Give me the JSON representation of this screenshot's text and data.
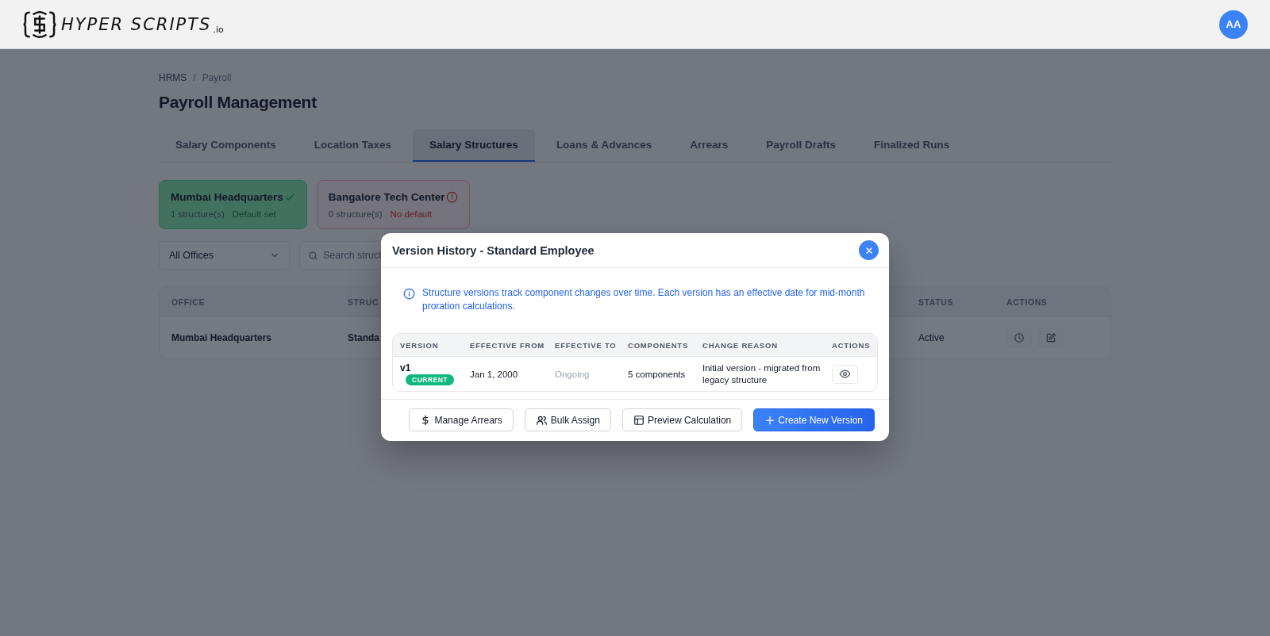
{
  "header": {
    "logo_text": "HYPER SCRIPTS",
    "logo_suffix": ".io",
    "avatar": "AA"
  },
  "breadcrumb": {
    "items": [
      "HRMS",
      "Payroll"
    ],
    "separator": "/"
  },
  "title": "Payroll Management",
  "tabs": [
    {
      "label": "Salary Components",
      "selected": false
    },
    {
      "label": "Location Taxes",
      "selected": false
    },
    {
      "label": "Salary Structures",
      "selected": true
    },
    {
      "label": "Loans & Advances",
      "selected": false
    },
    {
      "label": "Arrears",
      "selected": false
    },
    {
      "label": "Payroll Drafts",
      "selected": false
    },
    {
      "label": "Finalized Runs",
      "selected": false
    }
  ],
  "office_cards": [
    {
      "name": "Mumbai Headquarters",
      "count": "1 structure(s)",
      "status": "Default set",
      "has_default": true
    },
    {
      "name": "Bangalore Tech Center",
      "count": "0 structure(s)",
      "status": "No default",
      "has_default": false
    }
  ],
  "filters": {
    "office": "All Offices",
    "search_placeholder": "Search struct"
  },
  "table": {
    "columns": [
      "OFFICE",
      "STRUC",
      "STATUS",
      "ACTIONS"
    ],
    "rows": [
      {
        "office": "Mumbai Headquarters",
        "structure": "Standa",
        "status": "Active"
      }
    ]
  },
  "modal": {
    "title": "Version History - Standard Employee",
    "info": "Structure versions track component changes over time. Each version has an effective date for mid-month proration calculations.",
    "columns": [
      "VERSION",
      "EFFECTIVE FROM",
      "EFFECTIVE TO",
      "COMPONENTS",
      "CHANGE REASON",
      "ACTIONS"
    ],
    "rows": [
      {
        "version": "v1",
        "badge": "CURRENT",
        "effective_from": "Jan 1, 2000",
        "effective_to": "Ongoing",
        "components": "5 components",
        "reason": "Initial version - migrated from legacy structure"
      }
    ],
    "buttons": [
      {
        "label": "Manage Arrears",
        "kind": "dollar"
      },
      {
        "label": "Bulk Assign",
        "kind": "users"
      },
      {
        "label": "Preview Calculation",
        "kind": "layout"
      },
      {
        "label": "Create New Version",
        "kind": "plus"
      }
    ]
  }
}
